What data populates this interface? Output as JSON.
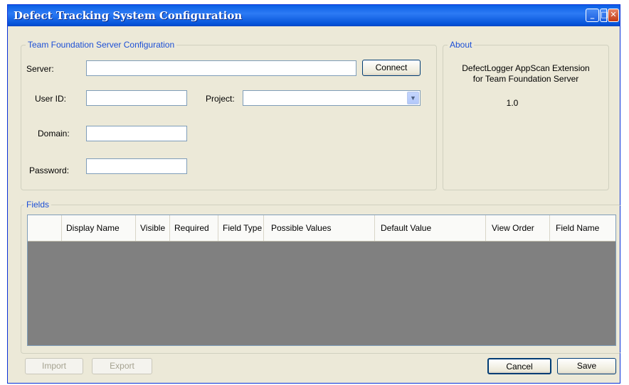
{
  "window": {
    "title": "Defect Tracking System Configuration"
  },
  "tfs_group": {
    "legend": "Team Foundation Server Configuration",
    "server_label": "Server:",
    "server_value": "",
    "connect_label": "Connect",
    "userid_label": "User ID:",
    "userid_value": "",
    "project_label": "Project:",
    "project_value": "",
    "domain_label": "Domain:",
    "domain_value": "",
    "password_label": "Password:",
    "password_value": ""
  },
  "about_group": {
    "legend": "About",
    "line1": "DefectLogger AppScan Extension",
    "line2": "for Team Foundation Server",
    "version": "1.0"
  },
  "fields_group": {
    "legend": "Fields",
    "columns": [
      "",
      "Display Name",
      "Visible",
      "Required",
      "Field Type",
      "Possible Values",
      "Default Value",
      "View Order",
      "Field Name"
    ],
    "rows": []
  },
  "buttons": {
    "import": "Import",
    "export": "Export",
    "cancel": "Cancel",
    "save": "Save"
  },
  "icons": {
    "minimize": "minimize-icon",
    "maximize": "maximize-icon",
    "close": "close-icon",
    "dropdown": "chevron-down-icon"
  }
}
